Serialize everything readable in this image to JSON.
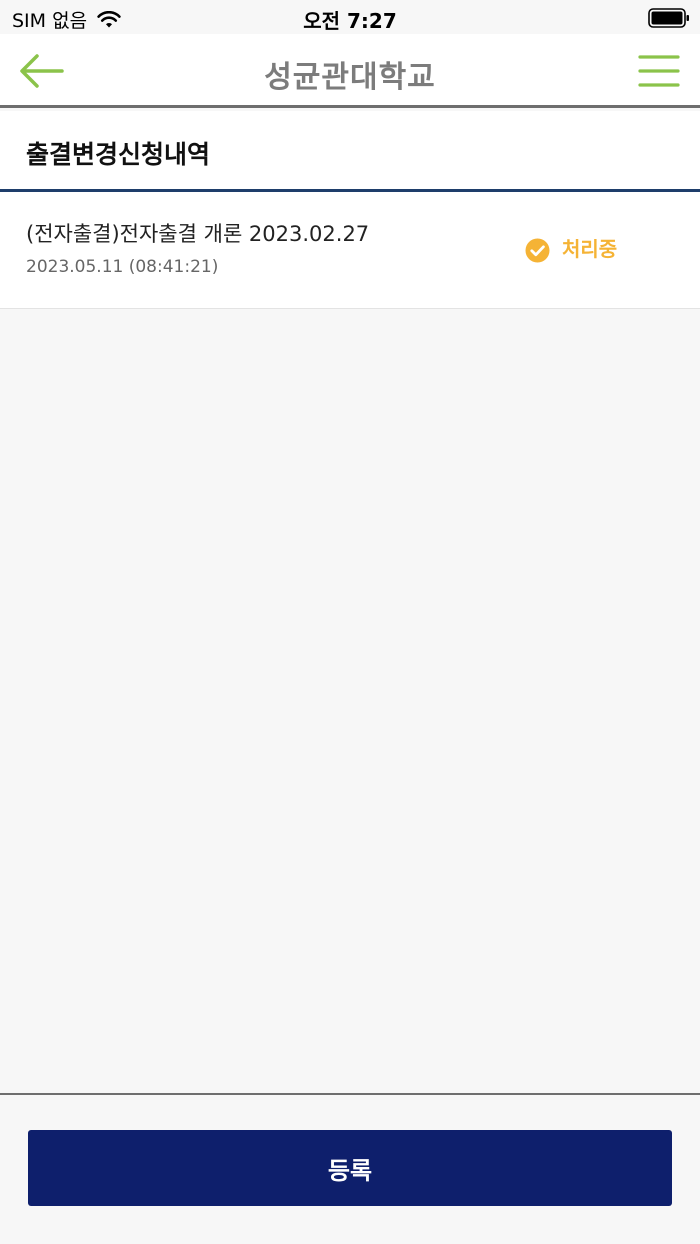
{
  "status_bar": {
    "carrier": "SIM 없음",
    "time": "오전 7:27"
  },
  "nav": {
    "title": "성균관대학교",
    "back_icon": "arrow-left-icon",
    "menu_icon": "hamburger-menu-icon",
    "accent_color": "#8bc34a"
  },
  "section": {
    "title": "출결변경신청내역"
  },
  "list": {
    "items": [
      {
        "title": "(전자출결)전자출결 개론 2023.02.27",
        "date": "2023.05.11 (08:41:21)",
        "status": "처리중",
        "status_icon": "check-circle-icon",
        "status_color": "#f5b335"
      }
    ]
  },
  "footer": {
    "register_label": "등록",
    "button_color": "#0e1f6c"
  }
}
